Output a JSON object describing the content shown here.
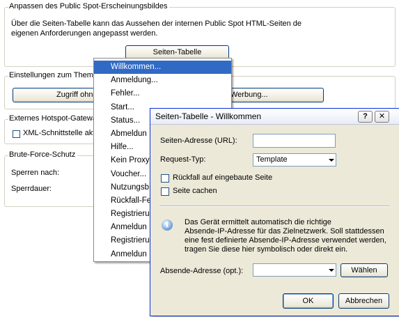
{
  "sections": {
    "appearance": {
      "title": "Anpassen des Public Spot-Erscheinungsbildes",
      "description_line1": "Über die Seiten-Tabelle kann das Aussehen der internen Public Spot HTML-Seiten de",
      "description_line2": "eigenen Anforderungen angepasst werden.",
      "button_label": "Seiten-Tabelle"
    },
    "theme": {
      "title": "Einstellungen zum Thema",
      "button1_label": "Zugriff ohne Ar",
      "button2_label": "Werbung..."
    },
    "external": {
      "title": "Externes Hotspot-Gatewa",
      "checkbox_label": "XML-Schnittstelle akt"
    },
    "bruteforce": {
      "title": "Brute-Force-Schutz",
      "lock_label": "Sperren nach:",
      "duration_label": "Sperrdauer:"
    }
  },
  "dropdown_menu": {
    "items": [
      "Willkommen...",
      "Anmeldung...",
      "Fehler...",
      "Start...",
      "Status...",
      "Abmeldun",
      "Hilfe...",
      "Kein Proxy",
      "Voucher...",
      "Nutzungsb",
      "Rückfall-Fe",
      "Registrieru",
      "Anmeldun",
      "Registrieru",
      "Anmeldun"
    ],
    "selected_index": 0
  },
  "dialog": {
    "title": "Seiten-Tabelle - Willkommen",
    "help_glyph": "?",
    "close_glyph": "✕",
    "url_label": "Seiten-Adresse (URL):",
    "url_value": "",
    "request_type_label": "Request-Typ:",
    "request_type_value": "Template",
    "fallback_label": "Rückfall auf eingebaute Seite",
    "cache_label": "Seite cachen",
    "info_line1": "Das Gerät ermittelt automatisch die richtige",
    "info_line2": "Absende-IP-Adresse für das Zielnetzwerk. Soll stattdessen",
    "info_line3": "eine fest definierte Absende-IP-Adresse verwendet werden,",
    "info_line4": "tragen Sie diese hier symbolisch oder direkt ein.",
    "sender_label": "Absende-Adresse (opt.):",
    "sender_value": "",
    "choose_button": "Wählen",
    "ok_button": "OK",
    "cancel_button": "Abbrechen",
    "info_icon": "info-icon",
    "accent_color": "#316ac5"
  }
}
